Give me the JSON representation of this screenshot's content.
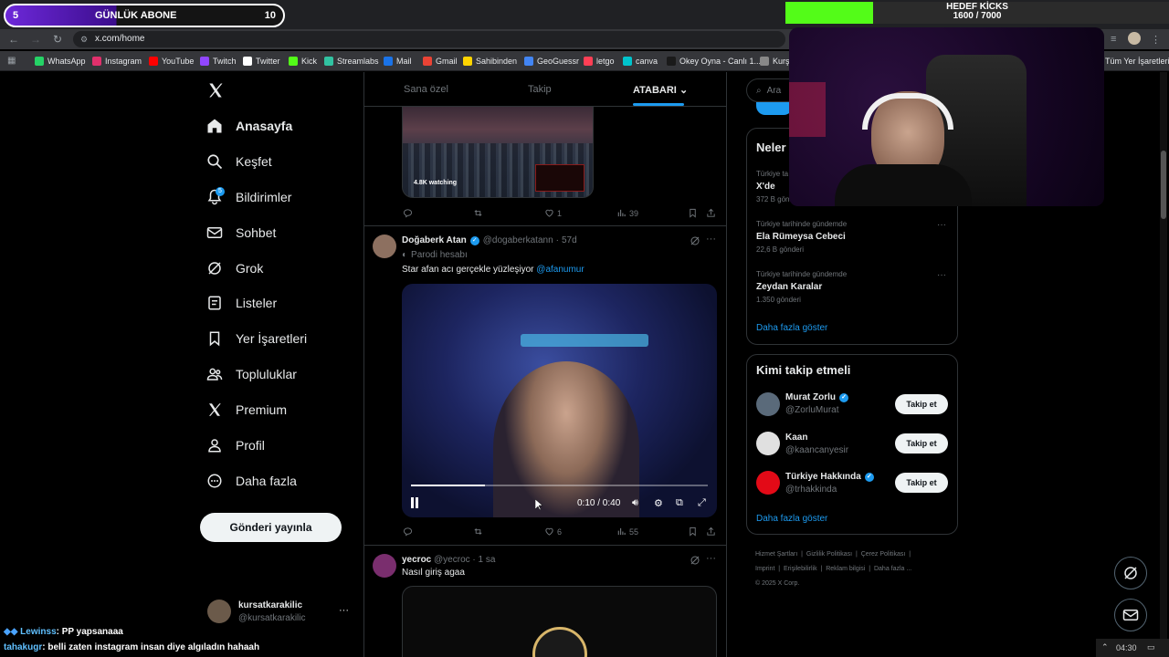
{
  "overlay": {
    "sub_goal_count": "5",
    "sub_goal_label": "GÜNLÜK ABONE",
    "sub_goal_target": "10",
    "kick_title": "HEDEF KİCKS",
    "kick_progress_text": "1600 / 7000",
    "kick_progress": 0.229
  },
  "browser": {
    "url": "x.com/home",
    "bookmarks": [
      "WhatsApp",
      "Instagram",
      "YouTube",
      "Twitch",
      "Twitter",
      "Kick",
      "Streamlabs",
      "Mail",
      "Gmail",
      "Sahibinden",
      "GeoGuessr",
      "letgo",
      "canva",
      "Okey Oyna - Canlı 1...",
      "Kurşa"
    ],
    "all_bookmarks": "Tüm Yer İşaretleri"
  },
  "nav": {
    "home": "Anasayfa",
    "explore": "Keşfet",
    "notifications": "Bildirimler",
    "notif_badge": "5",
    "chat": "Sohbet",
    "grok": "Grok",
    "lists": "Listeler",
    "bookmarks": "Yer İşaretleri",
    "communities": "Topluluklar",
    "premium": "Premium",
    "profile": "Profil",
    "more": "Daha fazla",
    "post": "Gönderi yayınla",
    "user_name": "kursatkarakilic",
    "user_handle": "@kursatkarakilic"
  },
  "feed": {
    "tabs": [
      "Sana özel",
      "Takip",
      "ATABARI"
    ],
    "post1": {
      "live_label": "4.8K watching",
      "replies": "",
      "retweets": "",
      "likes": "1",
      "views": "39"
    },
    "post2": {
      "name": "Doğaberk Atan",
      "handle": "@dogaberkatann",
      "time": "57d",
      "parody": "Parodi hesabı",
      "text": "Star afan acı gerçekle yüzleşiyor ",
      "mention": "@afanumur",
      "video_time": "0:10 / 0:40",
      "video_progress": 0.25,
      "likes": "6",
      "views": "55"
    },
    "post3": {
      "name": "yecroc",
      "handle": "@yecroc",
      "time": "1 sa",
      "text": "Nasıl giriş agaa"
    }
  },
  "sidebar": {
    "search_placeholder": "Ara",
    "trends_title": "Neler",
    "trends": [
      {
        "context": "Türkiye ta",
        "name": "X'de",
        "posts": "372 B gönd"
      },
      {
        "context": "Türkiye tarihinde gündemde",
        "name": "Ela Rümeysa Cebeci",
        "posts": "22,6 B gönderi"
      },
      {
        "context": "Türkiye tarihinde gündemde",
        "name": "Zeydan Karalar",
        "posts": "1.350 gönderi"
      }
    ],
    "show_more": "Daha fazla göster",
    "who_to_follow": "Kimi takip etmeli",
    "follow_btn": "Takip et",
    "suggestions": [
      {
        "name": "Murat Zorlu",
        "handle": "@ZorluMurat",
        "verified": true
      },
      {
        "name": "Kaan",
        "handle": "@kaancanyesir",
        "verified": false
      },
      {
        "name": "Türkiye Hakkında",
        "handle": "@trhakkinda",
        "verified": true
      }
    ],
    "footer": [
      "Hizmet Şartları",
      "Gizlilik Politikası",
      "Çerez Politikası",
      "Imprint",
      "Erişilebilirlik",
      "Reklam bilgisi",
      "Daha fazla ..."
    ],
    "copyright": "© 2025 X Corp."
  },
  "chat": [
    {
      "user": "Lewinss",
      "msg": ": PP yapsanaaa"
    },
    {
      "user": "tahakugr",
      "msg": ": belli zaten instagram insan diye algıladın hahaah"
    }
  ],
  "clock": "04:30",
  "colors": {
    "accent": "#1d9bf0",
    "kick_green": "#53fc18",
    "sub_purple": "#6d28d9"
  }
}
